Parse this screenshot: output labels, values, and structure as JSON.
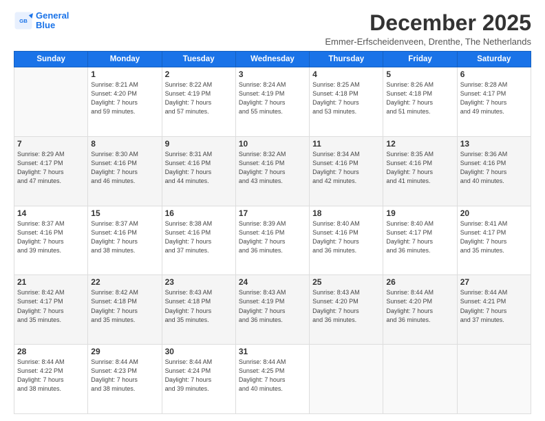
{
  "logo": {
    "line1": "General",
    "line2": "Blue"
  },
  "title": "December 2025",
  "subtitle": "Emmer-Erfscheidenveen, Drenthe, The Netherlands",
  "weekdays": [
    "Sunday",
    "Monday",
    "Tuesday",
    "Wednesday",
    "Thursday",
    "Friday",
    "Saturday"
  ],
  "weeks": [
    [
      {
        "day": "",
        "info": ""
      },
      {
        "day": "1",
        "info": "Sunrise: 8:21 AM\nSunset: 4:20 PM\nDaylight: 7 hours\nand 59 minutes."
      },
      {
        "day": "2",
        "info": "Sunrise: 8:22 AM\nSunset: 4:19 PM\nDaylight: 7 hours\nand 57 minutes."
      },
      {
        "day": "3",
        "info": "Sunrise: 8:24 AM\nSunset: 4:19 PM\nDaylight: 7 hours\nand 55 minutes."
      },
      {
        "day": "4",
        "info": "Sunrise: 8:25 AM\nSunset: 4:18 PM\nDaylight: 7 hours\nand 53 minutes."
      },
      {
        "day": "5",
        "info": "Sunrise: 8:26 AM\nSunset: 4:18 PM\nDaylight: 7 hours\nand 51 minutes."
      },
      {
        "day": "6",
        "info": "Sunrise: 8:28 AM\nSunset: 4:17 PM\nDaylight: 7 hours\nand 49 minutes."
      }
    ],
    [
      {
        "day": "7",
        "info": "Sunrise: 8:29 AM\nSunset: 4:17 PM\nDaylight: 7 hours\nand 47 minutes."
      },
      {
        "day": "8",
        "info": "Sunrise: 8:30 AM\nSunset: 4:16 PM\nDaylight: 7 hours\nand 46 minutes."
      },
      {
        "day": "9",
        "info": "Sunrise: 8:31 AM\nSunset: 4:16 PM\nDaylight: 7 hours\nand 44 minutes."
      },
      {
        "day": "10",
        "info": "Sunrise: 8:32 AM\nSunset: 4:16 PM\nDaylight: 7 hours\nand 43 minutes."
      },
      {
        "day": "11",
        "info": "Sunrise: 8:34 AM\nSunset: 4:16 PM\nDaylight: 7 hours\nand 42 minutes."
      },
      {
        "day": "12",
        "info": "Sunrise: 8:35 AM\nSunset: 4:16 PM\nDaylight: 7 hours\nand 41 minutes."
      },
      {
        "day": "13",
        "info": "Sunrise: 8:36 AM\nSunset: 4:16 PM\nDaylight: 7 hours\nand 40 minutes."
      }
    ],
    [
      {
        "day": "14",
        "info": "Sunrise: 8:37 AM\nSunset: 4:16 PM\nDaylight: 7 hours\nand 39 minutes."
      },
      {
        "day": "15",
        "info": "Sunrise: 8:37 AM\nSunset: 4:16 PM\nDaylight: 7 hours\nand 38 minutes."
      },
      {
        "day": "16",
        "info": "Sunrise: 8:38 AM\nSunset: 4:16 PM\nDaylight: 7 hours\nand 37 minutes."
      },
      {
        "day": "17",
        "info": "Sunrise: 8:39 AM\nSunset: 4:16 PM\nDaylight: 7 hours\nand 36 minutes."
      },
      {
        "day": "18",
        "info": "Sunrise: 8:40 AM\nSunset: 4:16 PM\nDaylight: 7 hours\nand 36 minutes."
      },
      {
        "day": "19",
        "info": "Sunrise: 8:40 AM\nSunset: 4:17 PM\nDaylight: 7 hours\nand 36 minutes."
      },
      {
        "day": "20",
        "info": "Sunrise: 8:41 AM\nSunset: 4:17 PM\nDaylight: 7 hours\nand 35 minutes."
      }
    ],
    [
      {
        "day": "21",
        "info": "Sunrise: 8:42 AM\nSunset: 4:17 PM\nDaylight: 7 hours\nand 35 minutes."
      },
      {
        "day": "22",
        "info": "Sunrise: 8:42 AM\nSunset: 4:18 PM\nDaylight: 7 hours\nand 35 minutes."
      },
      {
        "day": "23",
        "info": "Sunrise: 8:43 AM\nSunset: 4:18 PM\nDaylight: 7 hours\nand 35 minutes."
      },
      {
        "day": "24",
        "info": "Sunrise: 8:43 AM\nSunset: 4:19 PM\nDaylight: 7 hours\nand 36 minutes."
      },
      {
        "day": "25",
        "info": "Sunrise: 8:43 AM\nSunset: 4:20 PM\nDaylight: 7 hours\nand 36 minutes."
      },
      {
        "day": "26",
        "info": "Sunrise: 8:44 AM\nSunset: 4:20 PM\nDaylight: 7 hours\nand 36 minutes."
      },
      {
        "day": "27",
        "info": "Sunrise: 8:44 AM\nSunset: 4:21 PM\nDaylight: 7 hours\nand 37 minutes."
      }
    ],
    [
      {
        "day": "28",
        "info": "Sunrise: 8:44 AM\nSunset: 4:22 PM\nDaylight: 7 hours\nand 38 minutes."
      },
      {
        "day": "29",
        "info": "Sunrise: 8:44 AM\nSunset: 4:23 PM\nDaylight: 7 hours\nand 38 minutes."
      },
      {
        "day": "30",
        "info": "Sunrise: 8:44 AM\nSunset: 4:24 PM\nDaylight: 7 hours\nand 39 minutes."
      },
      {
        "day": "31",
        "info": "Sunrise: 8:44 AM\nSunset: 4:25 PM\nDaylight: 7 hours\nand 40 minutes."
      },
      {
        "day": "",
        "info": ""
      },
      {
        "day": "",
        "info": ""
      },
      {
        "day": "",
        "info": ""
      }
    ]
  ]
}
